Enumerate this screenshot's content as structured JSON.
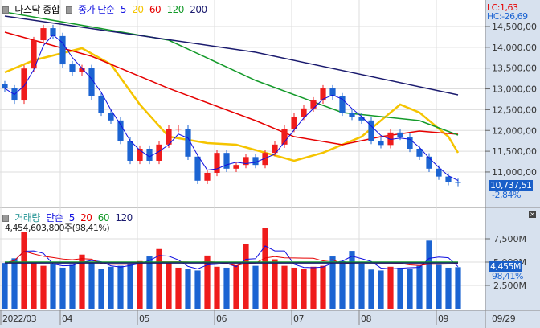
{
  "header": {
    "title": "나스닥 종합",
    "ma_label": "종가 단순",
    "ma_periods": [
      "5",
      "20",
      "60",
      "120",
      "200"
    ]
  },
  "colors": {
    "up": "#ef1c1c",
    "down": "#1c64d2",
    "ma5": "#1010e0",
    "ma20": "#f5c400",
    "ma60": "#e60000",
    "ma120": "#149a2a",
    "ma200": "#1a1a6e",
    "axis_bg": "#d7e1ee"
  },
  "price_panel": {
    "lc": "LC:1,63",
    "hc": "HC:-26,69",
    "current": "10,737,51",
    "change": "-2,84%"
  },
  "volume_panel": {
    "title": "거래량",
    "ma_label": "단순",
    "ma_periods": [
      "5",
      "20",
      "60",
      "120"
    ],
    "summary": "4,454,603,800주(98,41%)",
    "current": "4,455M",
    "ratio": "98,41%",
    "close_button": "×"
  },
  "x_axis": {
    "labels": [
      "2022/03",
      "04",
      "05",
      "06",
      "07",
      "08",
      "09"
    ],
    "end_label": "09/29"
  },
  "chart_data": [
    {
      "type": "candlestick",
      "title": "나스닥 종합",
      "ylim": [
        10500,
        14900
      ],
      "yticks": [
        14500,
        14000,
        13500,
        13000,
        12500,
        12000,
        11500,
        11000
      ],
      "ytick_labels": [
        "14,500,00",
        "14,000,00",
        "13,500,00",
        "13,000,00",
        "12,500,00",
        "12,000,00",
        "11,500,00",
        "11,000,00"
      ],
      "month_start_index": [
        0,
        6,
        14,
        22,
        30,
        37,
        45
      ],
      "close": [
        13010,
        12720,
        13490,
        14170,
        14460,
        14270,
        13590,
        13400,
        13500,
        12820,
        12430,
        12240,
        11750,
        11270,
        11560,
        11270,
        11660,
        12040,
        12040,
        11370,
        10790,
        10980,
        11460,
        11080,
        11170,
        11360,
        11170,
        11460,
        11660,
        12040,
        12330,
        12530,
        12720,
        13010,
        12820,
        12430,
        12330,
        12240,
        11750,
        11650,
        11950,
        11850,
        11560,
        11370,
        11080,
        10890,
        10760,
        10737
      ],
      "ma_series": [
        {
          "name": "MA20",
          "color_key": "ma20",
          "points": [
            [
              0,
              13398
            ],
            [
              3,
              13688
            ],
            [
              8,
              13978
            ],
            [
              11,
              13591
            ],
            [
              14,
              12624
            ],
            [
              17,
              11850
            ],
            [
              21,
              11696
            ],
            [
              24,
              11657
            ],
            [
              27,
              11464
            ],
            [
              30,
              11270
            ],
            [
              33,
              11464
            ],
            [
              37,
              11850
            ],
            [
              40,
              12431
            ],
            [
              41,
              12624
            ],
            [
              43,
              12431
            ],
            [
              46,
              11850
            ],
            [
              47,
              11464
            ]
          ]
        },
        {
          "name": "MA60",
          "color_key": "ma60",
          "points": [
            [
              0,
              14365
            ],
            [
              9,
              13784
            ],
            [
              17,
              13011
            ],
            [
              26,
              12237
            ],
            [
              30,
              11850
            ],
            [
              35,
              11657
            ],
            [
              39,
              11850
            ],
            [
              43,
              11986
            ],
            [
              47,
              11909
            ]
          ]
        },
        {
          "name": "MA120",
          "color_key": "ma120",
          "points": [
            [
              0,
              14848
            ],
            [
              17,
              14171
            ],
            [
              26,
              13204
            ],
            [
              35,
              12431
            ],
            [
              43,
              12237
            ],
            [
              47,
              11889
            ]
          ]
        },
        {
          "name": "MA200",
          "color_key": "ma200",
          "points": [
            [
              0,
              14751
            ],
            [
              26,
              13881
            ],
            [
              47,
              12856
            ]
          ]
        }
      ]
    },
    {
      "type": "bar",
      "title": "거래량",
      "ylim": [
        0,
        10000
      ],
      "yticks": [
        7500,
        5000,
        2500
      ],
      "ytick_labels": [
        "7,500M",
        "5,000M",
        "2,500M"
      ],
      "values": [
        4900,
        5400,
        8200,
        5000,
        4600,
        4800,
        4400,
        4700,
        5800,
        5000,
        4300,
        4500,
        4600,
        4800,
        5100,
        5600,
        6400,
        4900,
        4400,
        4300,
        4100,
        5700,
        4500,
        4400,
        4600,
        6900,
        4600,
        8700,
        5300,
        4600,
        4400,
        4300,
        4500,
        4600,
        5600,
        5100,
        6200,
        4800,
        4200,
        4100,
        4500,
        4400,
        4300,
        4600,
        7300,
        4700,
        4400,
        4455
      ],
      "ma_levels": [
        {
          "name": "MA60",
          "color_key": "ma120",
          "value": 5000
        },
        {
          "name": "MA120",
          "color_key": "ma200",
          "value": 4900
        }
      ]
    }
  ]
}
